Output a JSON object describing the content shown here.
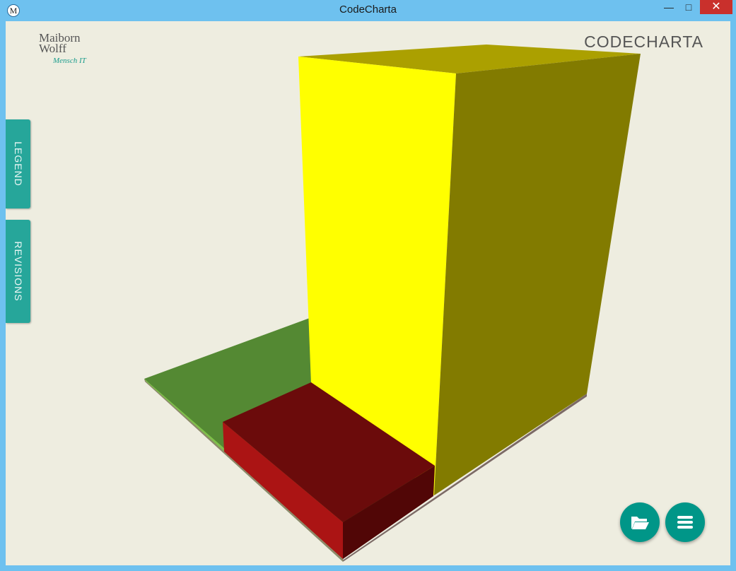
{
  "window": {
    "title": "CodeCharta",
    "app_icon_letter": "M",
    "minimize_symbol": "—",
    "maximize_symbol": "□",
    "close_symbol": "✕"
  },
  "logo": {
    "line1": "Maiborn",
    "line2": "Wolff",
    "tagline": "Mensch IT"
  },
  "brand": "CODECHARTA",
  "side_tabs": {
    "legend": "LEGEND",
    "revisions": "REVISIONS"
  },
  "buttons": {
    "open_icon": "folder-open-icon",
    "menu_icon": "menu-icon"
  },
  "colors": {
    "accent": "#009688",
    "tab": "#26a69a",
    "background": "#eeede0",
    "titlebar": "#6ec1ef",
    "building_yellow": "#ffff00",
    "building_red": "#6b0b0b",
    "floor_green": "#548933"
  }
}
